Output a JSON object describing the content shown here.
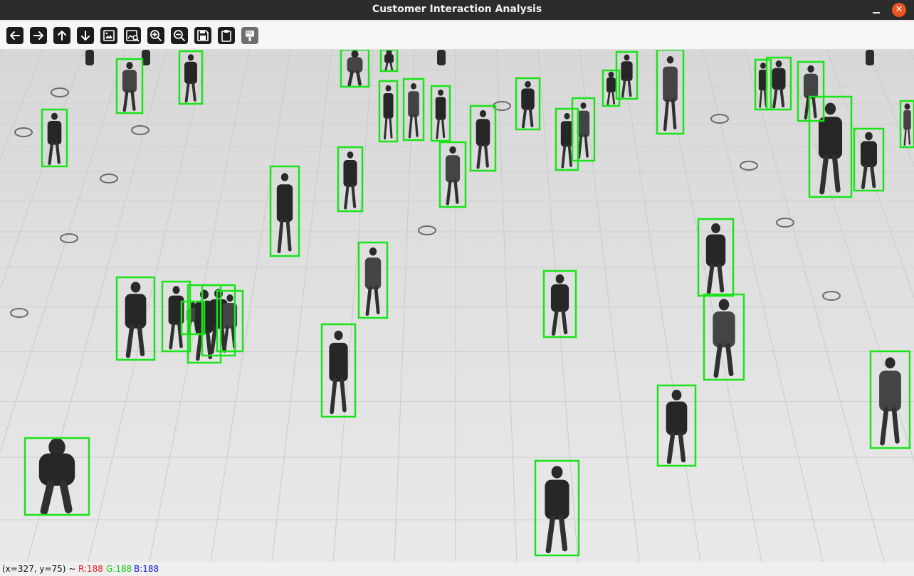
{
  "window": {
    "title": "Customer Interaction Analysis",
    "close_glyph": "✕",
    "close_color": "#e95420"
  },
  "toolbar": {
    "buttons": [
      {
        "name": "pan-left-button",
        "icon": "arrow-left-icon"
      },
      {
        "name": "pan-right-button",
        "icon": "arrow-right-icon"
      },
      {
        "name": "pan-up-button",
        "icon": "arrow-up-icon"
      },
      {
        "name": "pan-down-button",
        "icon": "arrow-down-icon"
      },
      {
        "name": "zoom-fit-button",
        "icon": "image-icon"
      },
      {
        "name": "zoom-original-button",
        "icon": "image-search-icon"
      },
      {
        "name": "zoom-in-button",
        "icon": "zoom-in-icon"
      },
      {
        "name": "zoom-out-button",
        "icon": "zoom-out-icon"
      },
      {
        "name": "save-button",
        "icon": "floppy-disk-icon"
      },
      {
        "name": "copy-clipboard-button",
        "icon": "clipboard-icon"
      },
      {
        "name": "properties-button",
        "icon": "paint-brush-icon"
      }
    ]
  },
  "viewer": {
    "image_description": "grayscale overhead view of pedestrians on a tiled floor",
    "detection_box_color": "#18e418",
    "detection_count": 44
  },
  "status": {
    "coords": "(x=327, y=75) ~",
    "r": "R:188",
    "g": "G:188",
    "b": "B:188"
  }
}
